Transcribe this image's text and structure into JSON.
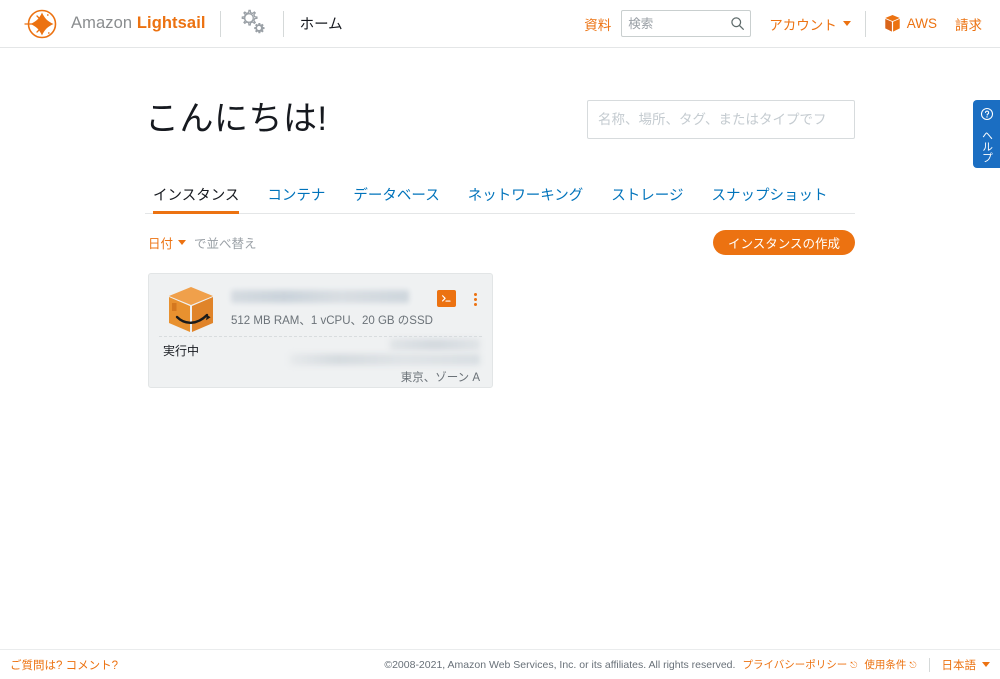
{
  "header": {
    "brand_amazon": "Amazon ",
    "brand_lightsail": "Lightsail",
    "logo_icon": "lightsail-logo-icon",
    "gear_icon": "gears-icon",
    "home_label": "ホーム",
    "docs_label": "資料",
    "search_placeholder": "検索",
    "search_value": "",
    "search_icon": "search-icon",
    "account_label": "アカウント",
    "aws_cube_icon": "aws-cube-icon",
    "aws_label": "AWS",
    "billing_label": "請求"
  },
  "main": {
    "greeting": "こんにちは!",
    "filter_placeholder": "名称、場所、タグ、またはタイプでフ",
    "filter_value": "",
    "tabs": [
      {
        "label": "インスタンス",
        "active": true
      },
      {
        "label": "コンテナ",
        "active": false
      },
      {
        "label": "データベース",
        "active": false
      },
      {
        "label": "ネットワーキング",
        "active": false
      },
      {
        "label": "ストレージ",
        "active": false
      },
      {
        "label": "スナップショット",
        "active": false
      }
    ],
    "sort": {
      "key_label": "日付",
      "suffix_label": "で並べ替え",
      "caret_icon": "chevron-down-icon"
    },
    "create_button_label": "インスタンスの作成"
  },
  "instance_card": {
    "instance_icon": "amazon-box-icon",
    "name_redacted": "",
    "specs": "512 MB RAM、1 vCPU、20 GB のSSD",
    "terminal_icon": "terminal-icon",
    "menu_icon": "kebab-menu-icon",
    "status": "実行中",
    "ip_redacted_1": "",
    "ip_redacted_2": "",
    "zone": "東京、ゾーン A"
  },
  "help_tab": {
    "icon": "question-circle-icon",
    "label": "ヘルプ"
  },
  "footer": {
    "feedback_label": "ご質問は? コメント?",
    "copyright": "©2008-2021, Amazon Web Services, Inc. or its affiliates. All rights reserved.",
    "privacy_label": "プライバシーポリシー",
    "terms_label": "使用条件",
    "external_icon": "external-link-icon",
    "language_label": "日本語"
  },
  "colors": {
    "accent_orange": "#ec7211",
    "link_blue": "#0073bb",
    "help_blue": "#1b6ec2",
    "card_bg": "#eff1f2",
    "text_dark": "#16191f"
  }
}
